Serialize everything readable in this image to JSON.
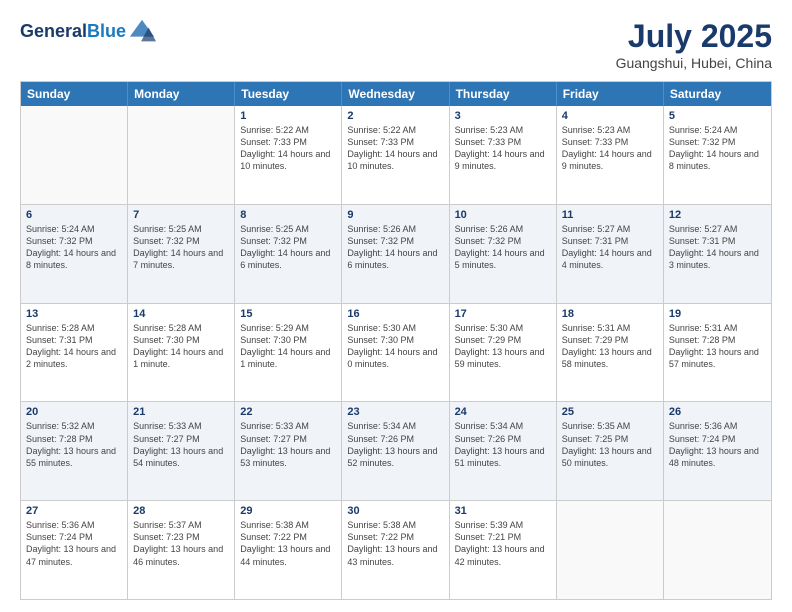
{
  "header": {
    "logo_line1": "General",
    "logo_line2": "Blue",
    "month": "July 2025",
    "location": "Guangshui, Hubei, China"
  },
  "weekdays": [
    "Sunday",
    "Monday",
    "Tuesday",
    "Wednesday",
    "Thursday",
    "Friday",
    "Saturday"
  ],
  "rows": [
    [
      {
        "day": "",
        "text": "",
        "empty": true
      },
      {
        "day": "",
        "text": "",
        "empty": true
      },
      {
        "day": "1",
        "text": "Sunrise: 5:22 AM\nSunset: 7:33 PM\nDaylight: 14 hours and 10 minutes."
      },
      {
        "day": "2",
        "text": "Sunrise: 5:22 AM\nSunset: 7:33 PM\nDaylight: 14 hours and 10 minutes."
      },
      {
        "day": "3",
        "text": "Sunrise: 5:23 AM\nSunset: 7:33 PM\nDaylight: 14 hours and 9 minutes."
      },
      {
        "day": "4",
        "text": "Sunrise: 5:23 AM\nSunset: 7:33 PM\nDaylight: 14 hours and 9 minutes."
      },
      {
        "day": "5",
        "text": "Sunrise: 5:24 AM\nSunset: 7:32 PM\nDaylight: 14 hours and 8 minutes."
      }
    ],
    [
      {
        "day": "6",
        "text": "Sunrise: 5:24 AM\nSunset: 7:32 PM\nDaylight: 14 hours and 8 minutes."
      },
      {
        "day": "7",
        "text": "Sunrise: 5:25 AM\nSunset: 7:32 PM\nDaylight: 14 hours and 7 minutes."
      },
      {
        "day": "8",
        "text": "Sunrise: 5:25 AM\nSunset: 7:32 PM\nDaylight: 14 hours and 6 minutes."
      },
      {
        "day": "9",
        "text": "Sunrise: 5:26 AM\nSunset: 7:32 PM\nDaylight: 14 hours and 6 minutes."
      },
      {
        "day": "10",
        "text": "Sunrise: 5:26 AM\nSunset: 7:32 PM\nDaylight: 14 hours and 5 minutes."
      },
      {
        "day": "11",
        "text": "Sunrise: 5:27 AM\nSunset: 7:31 PM\nDaylight: 14 hours and 4 minutes."
      },
      {
        "day": "12",
        "text": "Sunrise: 5:27 AM\nSunset: 7:31 PM\nDaylight: 14 hours and 3 minutes."
      }
    ],
    [
      {
        "day": "13",
        "text": "Sunrise: 5:28 AM\nSunset: 7:31 PM\nDaylight: 14 hours and 2 minutes."
      },
      {
        "day": "14",
        "text": "Sunrise: 5:28 AM\nSunset: 7:30 PM\nDaylight: 14 hours and 1 minute."
      },
      {
        "day": "15",
        "text": "Sunrise: 5:29 AM\nSunset: 7:30 PM\nDaylight: 14 hours and 1 minute."
      },
      {
        "day": "16",
        "text": "Sunrise: 5:30 AM\nSunset: 7:30 PM\nDaylight: 14 hours and 0 minutes."
      },
      {
        "day": "17",
        "text": "Sunrise: 5:30 AM\nSunset: 7:29 PM\nDaylight: 13 hours and 59 minutes."
      },
      {
        "day": "18",
        "text": "Sunrise: 5:31 AM\nSunset: 7:29 PM\nDaylight: 13 hours and 58 minutes."
      },
      {
        "day": "19",
        "text": "Sunrise: 5:31 AM\nSunset: 7:28 PM\nDaylight: 13 hours and 57 minutes."
      }
    ],
    [
      {
        "day": "20",
        "text": "Sunrise: 5:32 AM\nSunset: 7:28 PM\nDaylight: 13 hours and 55 minutes."
      },
      {
        "day": "21",
        "text": "Sunrise: 5:33 AM\nSunset: 7:27 PM\nDaylight: 13 hours and 54 minutes."
      },
      {
        "day": "22",
        "text": "Sunrise: 5:33 AM\nSunset: 7:27 PM\nDaylight: 13 hours and 53 minutes."
      },
      {
        "day": "23",
        "text": "Sunrise: 5:34 AM\nSunset: 7:26 PM\nDaylight: 13 hours and 52 minutes."
      },
      {
        "day": "24",
        "text": "Sunrise: 5:34 AM\nSunset: 7:26 PM\nDaylight: 13 hours and 51 minutes."
      },
      {
        "day": "25",
        "text": "Sunrise: 5:35 AM\nSunset: 7:25 PM\nDaylight: 13 hours and 50 minutes."
      },
      {
        "day": "26",
        "text": "Sunrise: 5:36 AM\nSunset: 7:24 PM\nDaylight: 13 hours and 48 minutes."
      }
    ],
    [
      {
        "day": "27",
        "text": "Sunrise: 5:36 AM\nSunset: 7:24 PM\nDaylight: 13 hours and 47 minutes."
      },
      {
        "day": "28",
        "text": "Sunrise: 5:37 AM\nSunset: 7:23 PM\nDaylight: 13 hours and 46 minutes."
      },
      {
        "day": "29",
        "text": "Sunrise: 5:38 AM\nSunset: 7:22 PM\nDaylight: 13 hours and 44 minutes."
      },
      {
        "day": "30",
        "text": "Sunrise: 5:38 AM\nSunset: 7:22 PM\nDaylight: 13 hours and 43 minutes."
      },
      {
        "day": "31",
        "text": "Sunrise: 5:39 AM\nSunset: 7:21 PM\nDaylight: 13 hours and 42 minutes."
      },
      {
        "day": "",
        "text": "",
        "empty": true
      },
      {
        "day": "",
        "text": "",
        "empty": true
      }
    ]
  ]
}
